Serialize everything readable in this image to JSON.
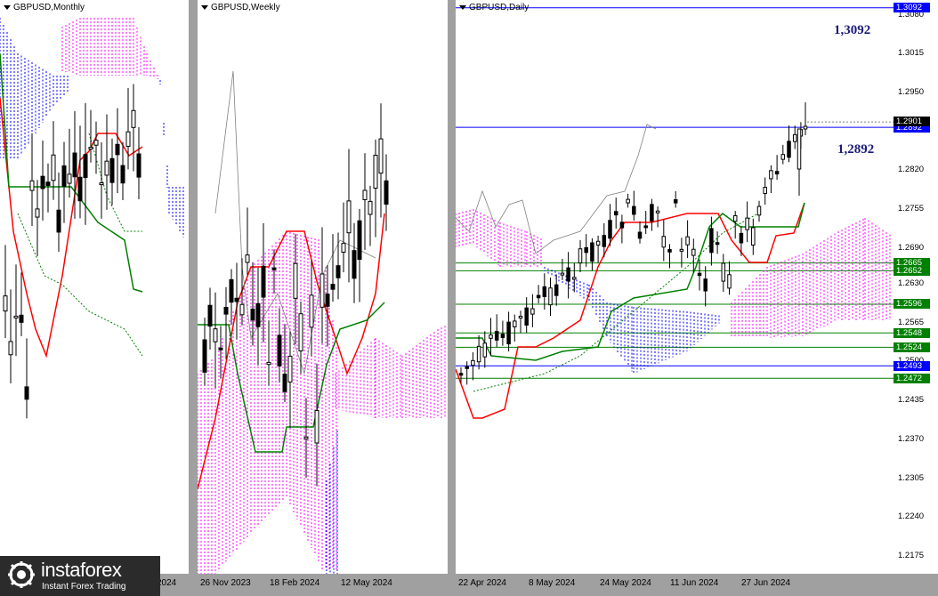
{
  "panels": {
    "monthly": {
      "title": "GBPUSD,Monthly",
      "xlabels": [
        "2024"
      ]
    },
    "weekly": {
      "title": "GBPUSD,Weekly",
      "xlabels": [
        "26 Nov 2023",
        "18 Feb 2024",
        "12 May 2024"
      ]
    },
    "daily": {
      "title": "GBPUSD,Daily",
      "xlabels": [
        "22 Apr 2024",
        "8 May 2024",
        "24 May 2024",
        "11 Jun 2024",
        "27 Jun 2024"
      ]
    }
  },
  "annotations": {
    "upper": "1,3092",
    "lower": "1,2892"
  },
  "logo": {
    "name": "instaforex",
    "tagline": "Instant Forex Trading"
  },
  "colors": {
    "bull_cloud": "#ff00ff",
    "bear_cloud": "#0000ff",
    "tenkan": "#ff0000",
    "kijun": "#008000",
    "chikou": "#008000",
    "candles": "#000000",
    "level_blue": "#0000ff"
  },
  "chart_data": [
    {
      "type": "candlestick",
      "symbol": "GBPUSD",
      "timeframe": "Monthly",
      "x_ticks": [
        "2024"
      ],
      "indicators": [
        "Ichimoku cloud",
        "Tenkan-sen",
        "Kijun-sen",
        "Chikou span"
      ]
    },
    {
      "type": "candlestick",
      "symbol": "GBPUSD",
      "timeframe": "Weekly",
      "x_ticks": [
        "26 Nov 2023",
        "18 Feb 2024",
        "12 May 2024"
      ],
      "indicators": [
        "Ichimoku cloud",
        "Tenkan-sen",
        "Kijun-sen",
        "Chikou span"
      ]
    },
    {
      "type": "candlestick",
      "symbol": "GBPUSD",
      "timeframe": "Daily",
      "x_ticks": [
        "22 Apr 2024",
        "8 May 2024",
        "24 May 2024",
        "11 Jun 2024",
        "27 Jun 2024"
      ],
      "y_ticks": [
        "1.3080",
        "1.3015",
        "1.2950",
        "1.2820",
        "1.2755",
        "1.2690",
        "1.2630",
        "1.2565",
        "1.2500",
        "1.2435",
        "1.2370",
        "1.2305",
        "1.2240",
        "1.2175"
      ],
      "ylim": [
        1.2145,
        1.3105
      ],
      "current_price": "1.2901",
      "levels": [
        {
          "label": "1.3092",
          "color": "#0000ff"
        },
        {
          "label": "1.2892",
          "color": "#0000ff"
        },
        {
          "label": "1.2665",
          "color": "#008000"
        },
        {
          "label": "1.2652",
          "color": "#008000"
        },
        {
          "label": "1.2596",
          "color": "#008000"
        },
        {
          "label": "1.2548",
          "color": "#008000"
        },
        {
          "label": "1.2524",
          "color": "#008000"
        },
        {
          "label": "1.2493",
          "color": "#0000ff"
        },
        {
          "label": "1.2472",
          "color": "#008000"
        }
      ],
      "indicators": [
        "Ichimoku cloud",
        "Tenkan-sen",
        "Kijun-sen",
        "Chikou span"
      ]
    }
  ]
}
